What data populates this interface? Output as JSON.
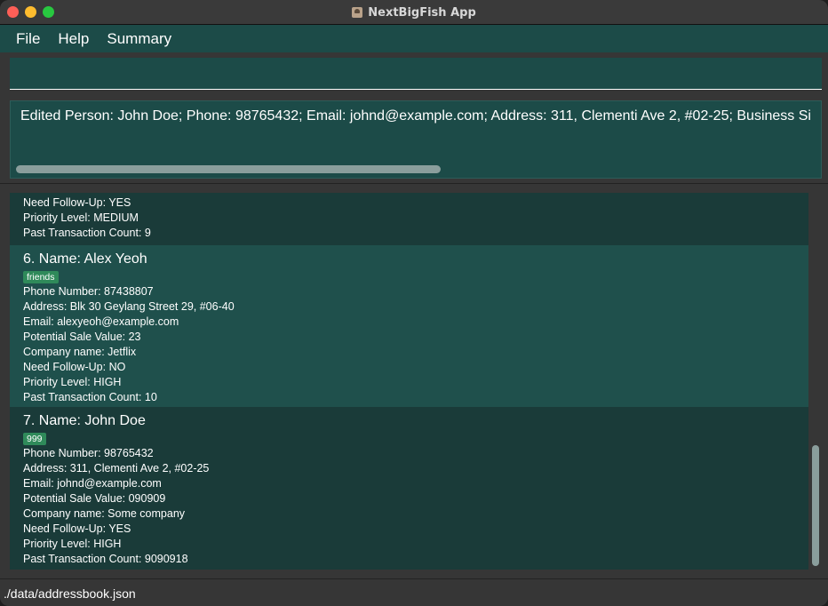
{
  "window": {
    "title": "NextBigFish App"
  },
  "menu": {
    "items": [
      "File",
      "Help",
      "Summary"
    ]
  },
  "command": {
    "value": "",
    "placeholder": ""
  },
  "result": {
    "text": "Edited Person: John Doe; Phone: 98765432; Email: johnd@example.com; Address: 311, Clementi Ave 2, #02-25; Business Si"
  },
  "list": {
    "partial_card": {
      "lines": [
        "Need Follow-Up: YES",
        "Priority Level: MEDIUM",
        "Past Transaction Count: 9"
      ]
    },
    "cards": [
      {
        "index_name": "6.  Name: Alex Yeoh",
        "tag": "friends",
        "phone": "Phone Number: 87438807",
        "address": "Address: Blk 30 Geylang Street 29, #06-40",
        "email": "Email: alexyeoh@example.com",
        "sale": "Potential Sale Value: 23",
        "company": "Company name: Jetflix",
        "followup": "Need Follow-Up: NO",
        "priority": "Priority Level: HIGH",
        "transactions": "Past Transaction Count: 10"
      },
      {
        "index_name": "7.  Name: John Doe",
        "tag": "999",
        "phone": "Phone Number: 98765432",
        "address": "Address: 311, Clementi Ave 2, #02-25",
        "email": "Email: johnd@example.com",
        "sale": "Potential Sale Value: 090909",
        "company": "Company name: Some company",
        "followup": "Need Follow-Up: YES",
        "priority": "Priority Level: HIGH",
        "transactions": "Past Transaction Count: 9090918"
      }
    ]
  },
  "status": {
    "path": "./data/addressbook.json"
  },
  "colors": {
    "panel": "#1c4b48",
    "card_dark": "#1a3b39",
    "card_light": "#1f504c",
    "tag": "#2f8a5a",
    "background": "#363636"
  }
}
